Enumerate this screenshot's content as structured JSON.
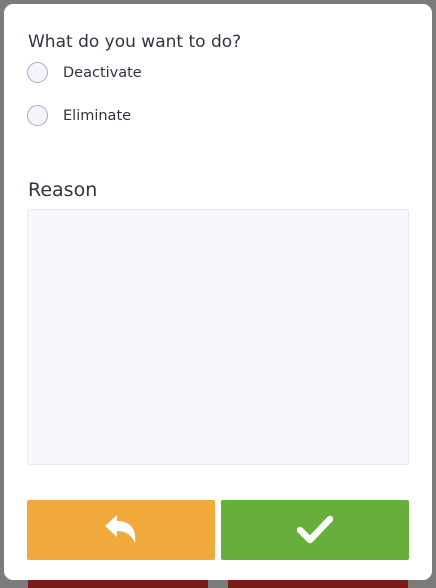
{
  "dialog": {
    "question": "What do you want to do?",
    "options": [
      {
        "label": "Deactivate",
        "selected": false
      },
      {
        "label": "Eliminate",
        "selected": false
      }
    ],
    "reason_title": "Reason",
    "reason_value": "",
    "back_button": {
      "icon": "reply-arrow-icon",
      "color": "#f0a93b"
    },
    "confirm_button": {
      "icon": "checkmark-icon",
      "color": "#67af3b"
    }
  }
}
